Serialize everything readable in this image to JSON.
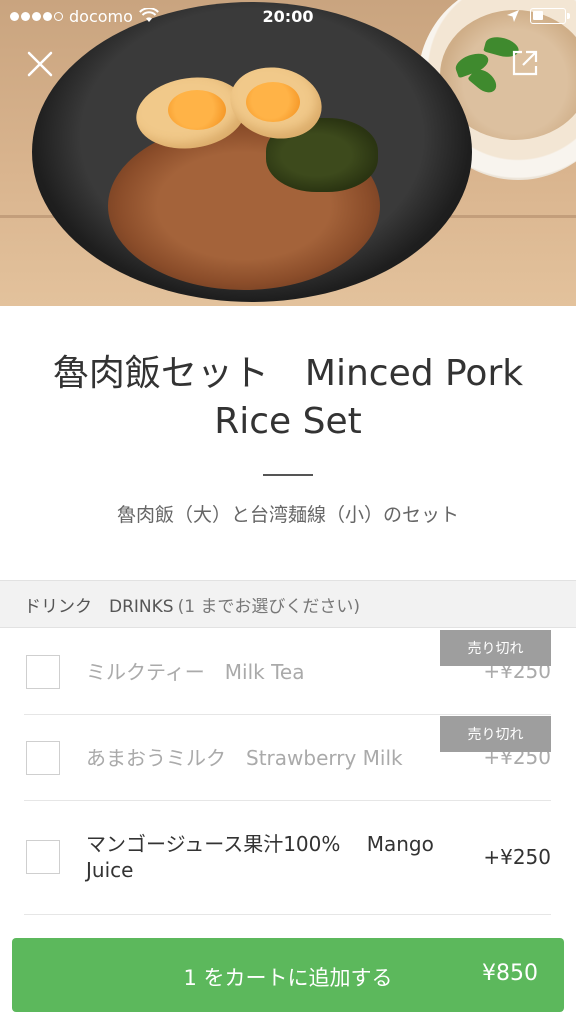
{
  "status_bar": {
    "carrier": "docomo",
    "time": "20:00",
    "signal_dots_filled": 4,
    "signal_dots_total": 5,
    "battery_level": 0.35
  },
  "header": {
    "close_icon": "close-icon",
    "share_icon": "external-share-icon"
  },
  "product": {
    "title": "魯肉飯セット　Minced Pork Rice Set",
    "description": "魯肉飯（大）と台湾麺線（小）のセット"
  },
  "drinks": {
    "header_label": "ドリンク　DRINKS",
    "header_hint": "(1 までお選びください)",
    "options": [
      {
        "label": "ミルクティー　Milk Tea",
        "price": "+¥250",
        "soldout_label": "売り切れ",
        "soldout": true
      },
      {
        "label": "あまおうミルク　Strawberry Milk",
        "price": "+¥250",
        "soldout_label": "売り切れ",
        "soldout": true
      },
      {
        "label": "マンゴージュース果汁100%　 Mango Juice",
        "price": "+¥250",
        "soldout": false
      }
    ]
  },
  "cart_button": {
    "label": "1 をカートに追加する",
    "price": "¥850"
  },
  "colors": {
    "accent_green": "#5cb85c",
    "soldout_badge": "#9e9e9e"
  }
}
